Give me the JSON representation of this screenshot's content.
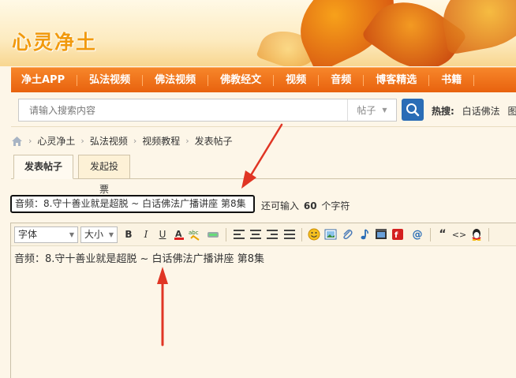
{
  "site": {
    "logo_text": "心灵净土"
  },
  "nav": {
    "items": [
      "净土APP",
      "弘法视频",
      "佛法视频",
      "佛教经文",
      "视频",
      "音频",
      "博客精选",
      "书籍"
    ]
  },
  "search": {
    "placeholder": "请输入搜索内容",
    "type_label": "帖子",
    "hot_label": "热搜:",
    "hot_links": [
      "白话佛法",
      "图"
    ]
  },
  "breadcrumb": [
    "心灵净土",
    "弘法视频",
    "视频教程",
    "发表帖子"
  ],
  "tabs": {
    "post": "发表帖子",
    "poll": "发起投票"
  },
  "title_field": {
    "value": "音频：8.守十善业就是超脱 ~ 白话佛法广播讲座 第8集",
    "remain_prefix": "还可输入",
    "remain_count": "60",
    "remain_suffix": "个字符"
  },
  "editor": {
    "font_label": "字体",
    "size_label": "大小",
    "content": "音频：8.守十善业就是超脱 ~ 白话佛法广播讲座 第8集"
  },
  "colors": {
    "nav_orange": "#e8620e",
    "arrow_red": "#e03524",
    "search_blue": "#2a6db6"
  }
}
